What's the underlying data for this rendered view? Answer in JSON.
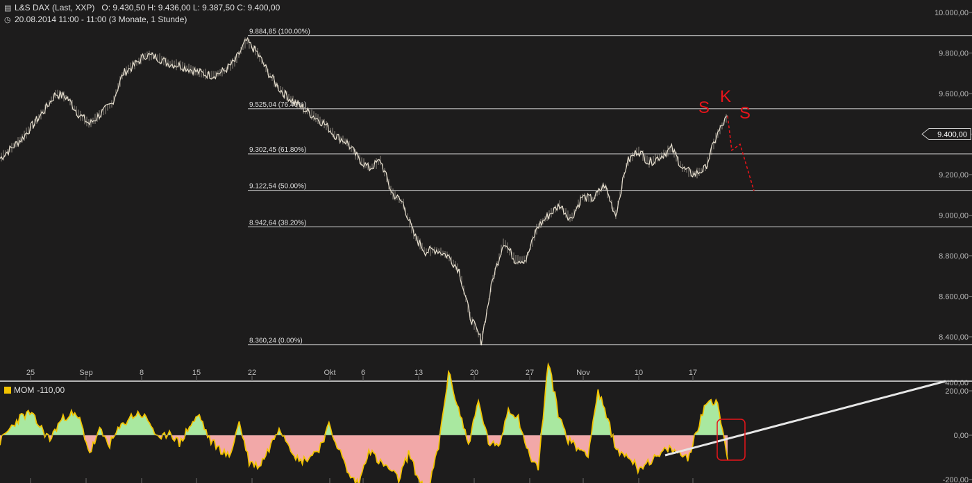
{
  "header": {
    "instrument": "L&S DAX (Last, XXP)",
    "ohlc": "O: 9.430,50  H: 9.436,00  L: 9.387,50  C: 9.400,00",
    "timeframe": "20.08.2014 11:00 - 11:00 (3 Monate, 1 Stunde)",
    "chart_icon": "bar-chart-icon",
    "clock_icon": "clock-icon"
  },
  "colors": {
    "background": "#1d1c1c",
    "price_line": "#e8e0d0",
    "fib_line": "#d9d9d9",
    "annotation": "#e8141a",
    "momentum_line": "#f2c300",
    "momentum_pos_fill": "#a9e8a0",
    "momentum_neg_fill": "#f2a8a8",
    "trendline": "#e6e6e6"
  },
  "chart_data": [
    {
      "type": "line",
      "title": "L&S DAX (Last, XXP)",
      "ylim": [
        8300,
        10000
      ],
      "y_ticks": [
        "10.000,00",
        "9.800,00",
        "9.600,00",
        "9.400,00",
        "9.200,00",
        "9.000,00",
        "8.800,00",
        "8.600,00",
        "8.400,00"
      ],
      "y_tick_values": [
        10000,
        9800,
        9600,
        9400,
        9200,
        9000,
        8800,
        8600,
        8400
      ],
      "x_ticks": [
        "25",
        "Sep",
        "8",
        "15",
        "22",
        "Okt",
        "6",
        "13",
        "20",
        "27",
        "Nov",
        "10",
        "17"
      ],
      "last_price_label": "9.400,00",
      "last_price": 9400,
      "fib_levels": [
        {
          "label": "9.884,85 (100.00%)",
          "value": 9884.85
        },
        {
          "label": "9.525,04 (76.40%)",
          "value": 9525.04
        },
        {
          "label": "9.302,45 (61.80%)",
          "value": 9302.45
        },
        {
          "label": "9.122,54 (50.00%)",
          "value": 9122.54
        },
        {
          "label": "8.942,64 (38.20%)",
          "value": 8942.64
        },
        {
          "label": "8.360,24 (0.00%)",
          "value": 8360.24
        }
      ],
      "series": [
        {
          "x": [
            0,
            1,
            2,
            3,
            4,
            5,
            6,
            7,
            8,
            9,
            10,
            11,
            12,
            13,
            14,
            15,
            16,
            17,
            18,
            19,
            20,
            21,
            22,
            23,
            24,
            25,
            26,
            27,
            28,
            29,
            30,
            31,
            32,
            33,
            34,
            35,
            36,
            37,
            38,
            39,
            40,
            41,
            42,
            43,
            44,
            45,
            46,
            47,
            48,
            49,
            50,
            51,
            52,
            53,
            54,
            55,
            56,
            57,
            58,
            59,
            60,
            61,
            62,
            63,
            64,
            65
          ],
          "values": [
            9280,
            9330,
            9380,
            9450,
            9520,
            9600,
            9580,
            9500,
            9450,
            9500,
            9550,
            9700,
            9740,
            9790,
            9780,
            9750,
            9740,
            9720,
            9700,
            9690,
            9710,
            9760,
            9860,
            9800,
            9700,
            9620,
            9570,
            9530,
            9490,
            9450,
            9390,
            9360,
            9280,
            9230,
            9270,
            9110,
            9060,
            8900,
            8820,
            8830,
            8800,
            8730,
            8500,
            8380,
            8680,
            8870,
            8780,
            8780,
            8940,
            9000,
            9050,
            8980,
            9090,
            9080,
            9150,
            9000,
            9260,
            9320,
            9260,
            9290,
            9330,
            9230,
            9200,
            9230,
            9390,
            9490
          ]
        },
        {
          "name": "S K S",
          "annotation_labels": [
            "S",
            "K",
            "S"
          ],
          "dashed_projection": [
            9490,
            9320,
            9350,
            9120
          ]
        }
      ]
    },
    {
      "type": "area",
      "title": "MOM",
      "legend_value": "-110,00",
      "ylim": [
        -300,
        400
      ],
      "y_ticks": [
        "200,00",
        "0,00",
        "-200,00"
      ],
      "y_tick_values": [
        200,
        0,
        -200
      ],
      "values": [
        -30,
        30,
        80,
        100,
        40,
        -20,
        60,
        100,
        70,
        -80,
        20,
        -40,
        30,
        80,
        100,
        60,
        -30,
        20,
        -40,
        40,
        90,
        -20,
        -60,
        -100,
        60,
        -120,
        -140,
        -60,
        40,
        -40,
        -120,
        -100,
        -60,
        40,
        -60,
        -180,
        -220,
        -60,
        -120,
        -150,
        -200,
        -80,
        -200,
        -240,
        -50,
        280,
        120,
        -40,
        150,
        -30,
        -60,
        120,
        80,
        -80,
        -150,
        330,
        100,
        -20,
        -60,
        -80,
        200,
        60,
        -80,
        -90,
        -150,
        -120,
        -100,
        -60,
        -80,
        -100,
        30,
        160,
        150,
        -110
      ]
    }
  ]
}
